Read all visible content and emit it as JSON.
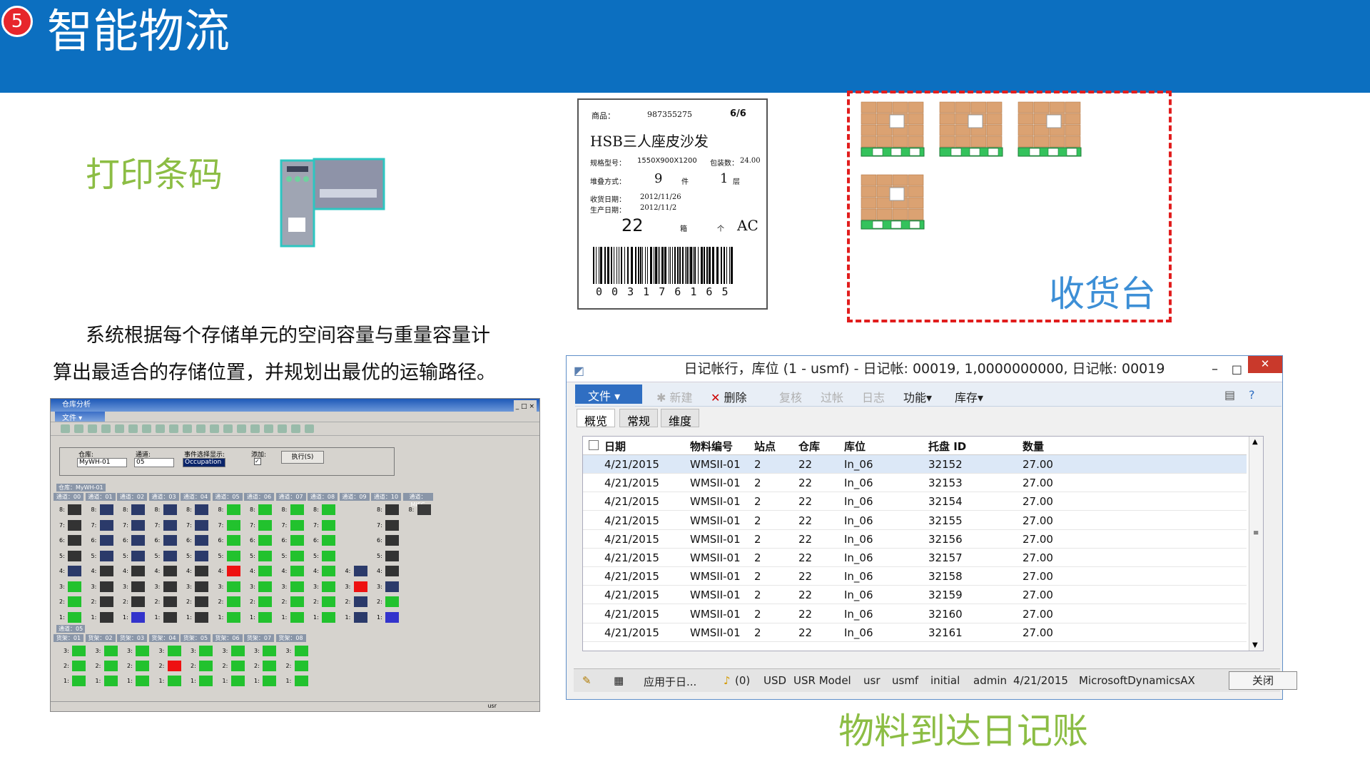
{
  "header": {
    "badge": "5",
    "title": "智能物流"
  },
  "print_barcode": {
    "label": "打印条码"
  },
  "description": {
    "line1": "系统根据每个存储单元的空间容量与重量容量计",
    "line2": "算出最适合的存储位置，并规划出最优的运输路径。"
  },
  "barcode_label": {
    "product_key": "商品：",
    "product_code": "987355275",
    "page": "6/6",
    "product_name": "HSB三人座皮沙发",
    "spec_key": "规格型号：",
    "spec_value": "1550X900X1200",
    "pack_key": "包装数：",
    "pack_value": "24.00",
    "stack_key": "堆叠方式：",
    "stack_pieces": "9",
    "piece_unit": "件",
    "stack_layers": "1",
    "layer_unit": "层",
    "receipt_key": "收货日期：",
    "receipt_date": "2012/11/26",
    "produce_key": "生产日期：",
    "produce_date": "2012/11/2",
    "count": "22",
    "box_unit": "箱",
    "each_unit": "个",
    "grade": "AC",
    "barcode_digits": "0 0 3 1 7 6 1 6 5"
  },
  "receiving_dock": {
    "label": "收货台"
  },
  "journal_caption": {
    "label": "物料到达日记账"
  },
  "warehouse_window": {
    "title": "仓库分析",
    "menu_file": "文件",
    "warehouse_key": "仓库:",
    "warehouse_value": "MyWH-01",
    "aisle_key": "通道:",
    "aisle_value": "05",
    "event_key": "事件选择显示:",
    "event_value": "Occupation",
    "add_key": "添加:",
    "run_button": "执行(S)",
    "group1": "仓库：MyWH-01",
    "group2": "通道：05",
    "aisles": [
      "通道：00",
      "通道：01",
      "通道：02",
      "通道：03",
      "通道：04",
      "通道：05",
      "通道：06",
      "通道：07",
      "通道：08",
      "通道：09",
      "通道：10",
      "通道：MISC"
    ],
    "racks": [
      "货架：01",
      "货架：02",
      "货架：03",
      "货架：04",
      "货架：05",
      "货架：06",
      "货架：07",
      "货架：08"
    ],
    "status_user": "usr"
  },
  "journal_window": {
    "title": "日记帐行，库位 (1 - usmf) - 日记帐: 00019, 1,0000000000, 日记帐: 00019",
    "file_btn": "文件",
    "new_btn": "新建",
    "delete_btn": "删除",
    "review_btn": "复核",
    "post_btn": "过帐",
    "log_btn": "日志",
    "func_btn": "功能",
    "inventory_btn": "库存",
    "tabs": [
      "概览",
      "常规",
      "维度"
    ],
    "columns": [
      "日期",
      "物料编号",
      "站点",
      "仓库",
      "库位",
      "托盘 ID",
      "数量"
    ],
    "rows": [
      [
        "4/21/2015",
        "WMSII-01",
        "2",
        "22",
        "In_06",
        "32152",
        "27.00"
      ],
      [
        "4/21/2015",
        "WMSII-01",
        "2",
        "22",
        "In_06",
        "32153",
        "27.00"
      ],
      [
        "4/21/2015",
        "WMSII-01",
        "2",
        "22",
        "In_06",
        "32154",
        "27.00"
      ],
      [
        "4/21/2015",
        "WMSII-01",
        "2",
        "22",
        "In_06",
        "32155",
        "27.00"
      ],
      [
        "4/21/2015",
        "WMSII-01",
        "2",
        "22",
        "In_06",
        "32156",
        "27.00"
      ],
      [
        "4/21/2015",
        "WMSII-01",
        "2",
        "22",
        "In_06",
        "32157",
        "27.00"
      ],
      [
        "4/21/2015",
        "WMSII-01",
        "2",
        "22",
        "In_06",
        "32158",
        "27.00"
      ],
      [
        "4/21/2015",
        "WMSII-01",
        "2",
        "22",
        "In_06",
        "32159",
        "27.00"
      ],
      [
        "4/21/2015",
        "WMSII-01",
        "2",
        "22",
        "In_06",
        "32160",
        "27.00"
      ],
      [
        "4/21/2015",
        "WMSII-01",
        "2",
        "22",
        "In_06",
        "32161",
        "27.00"
      ]
    ],
    "status_apply": "应用于日...",
    "status_alerts": "(0)",
    "status_currency": "USD",
    "status_model": "USR Model",
    "status_layer": "usr",
    "status_company": "usmf",
    "status_initial": "initial",
    "status_user": "admin",
    "status_date": "4/21/2015",
    "status_app": "MicrosoftDynamicsAX",
    "close_btn": "关闭"
  }
}
